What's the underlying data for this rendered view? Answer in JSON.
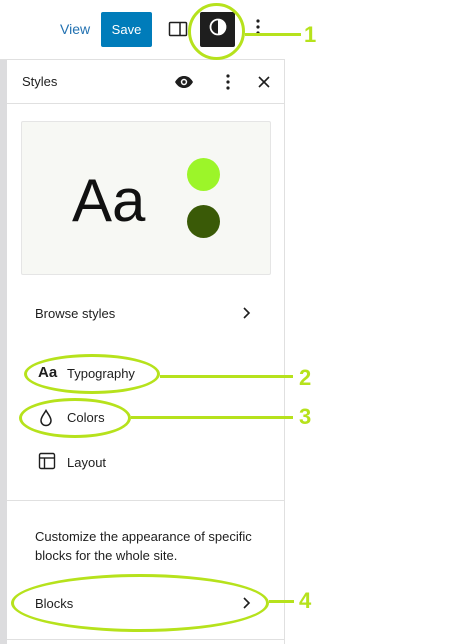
{
  "toolbar": {
    "view_label": "View",
    "save_label": "Save",
    "sidebar_icon": "sidebar-panel-icon",
    "styles_icon": "half-circle-contrast-icon",
    "more_icon": "vertical-dots-icon"
  },
  "panel": {
    "title": "Styles",
    "header_icons": [
      "eye-icon",
      "vertical-dots-icon",
      "close-icon"
    ],
    "preview": {
      "sample_text": "Aa",
      "colors": [
        "#9cf529",
        "#3a5a07"
      ]
    },
    "browse_label": "Browse styles",
    "items": [
      {
        "label": "Typography",
        "icon": "aa-typography-icon"
      },
      {
        "label": "Colors",
        "icon": "droplet-icon"
      },
      {
        "label": "Layout",
        "icon": "layout-icon"
      }
    ],
    "description": "Customize the appearance of specific blocks for the whole site.",
    "blocks_label": "Blocks"
  },
  "annotations": {
    "color": "#b6e21c",
    "labels": [
      "1",
      "2",
      "3",
      "4"
    ]
  },
  "colors": {
    "accent": "#007cba",
    "link": "#2271b1",
    "dark": "#1e1e1e"
  }
}
